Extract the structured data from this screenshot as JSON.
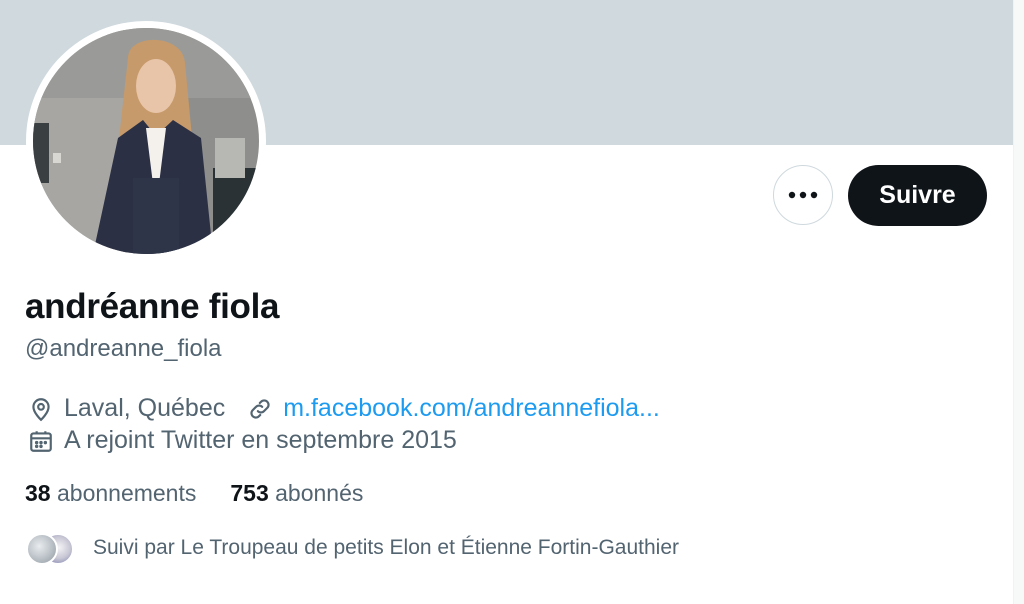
{
  "profile": {
    "display_name": "andréanne fiola",
    "handle": "@andreanne_fiola",
    "location": "Laval, Québec",
    "website": "m.facebook.com/andreannefiola...",
    "joined": "A rejoint Twitter en septembre 2015"
  },
  "actions": {
    "follow_label": "Suivre",
    "more_icon": "more-horizontal-icon"
  },
  "stats": {
    "following_count": "38",
    "following_label": "abonnements",
    "followers_count": "753",
    "followers_label": "abonnés"
  },
  "followed_by": {
    "text": "Suivi par Le Troupeau de petits Elon et Étienne Fortin-Gauthier"
  },
  "icons": {
    "location": "location-pin-icon",
    "link": "link-icon",
    "calendar": "calendar-icon"
  },
  "colors": {
    "banner": "#cfd9de",
    "follow_button": "#0f1419",
    "link": "#1d9bf0",
    "secondary_text": "#536471"
  }
}
